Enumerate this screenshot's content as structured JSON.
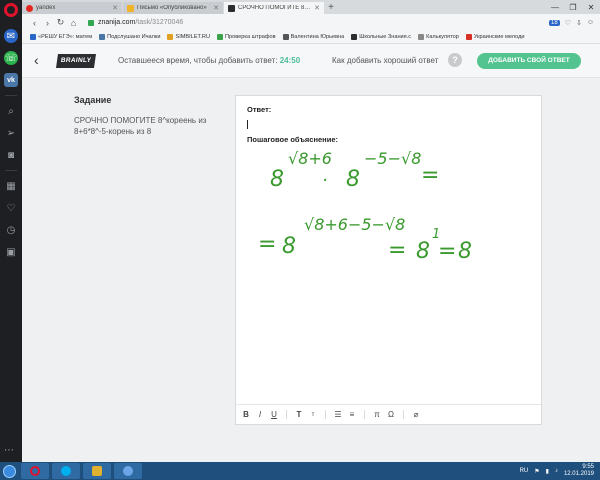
{
  "tabs": [
    {
      "label": "yandex",
      "favicon": "yandex-icon",
      "active": false
    },
    {
      "label": "Письмо «Опубликовано»",
      "favicon": "mail-icon",
      "active": false
    },
    {
      "label": "СРОЧНО ПОМОГИТЕ 8^ко",
      "favicon": "brainly-icon",
      "active": true
    }
  ],
  "address": {
    "domain": "znanija.com",
    "path": "/task/31270046",
    "badge": "18"
  },
  "bookmarks": [
    {
      "label": "«РЕШУ ЕГЭ»: матем",
      "color": "#2a66c7"
    },
    {
      "label": "Подслушано Ичалки",
      "color": "#4a76a8"
    },
    {
      "label": "SIMBILET.RU",
      "color": "#e0a020"
    },
    {
      "label": "Проверка штрафов",
      "color": "#3aa34a"
    },
    {
      "label": "Валентина Юрьевна",
      "color": "#555555"
    },
    {
      "label": "Школьные Знания.с",
      "color": "#2b2d30"
    },
    {
      "label": "Калькулятор",
      "color": "#888888"
    },
    {
      "label": "Украинские мелоди",
      "color": "#d93025"
    }
  ],
  "header": {
    "logo": "BRAINLY",
    "time_label": "Оставшееся время, чтобы добавить ответ:",
    "time_value": "24:50",
    "how_to": "Как добавить хороший ответ",
    "help": "?",
    "add_button": "ДОБАВИТЬ СВОЙ ОТВЕТ"
  },
  "task": {
    "title": "Задание",
    "text": "СРОЧНО ПОМОГИТЕ 8^кореень из 8+6*8^-5-корень из 8"
  },
  "editor": {
    "answer_label": "Ответ:",
    "explanation_label": "Пошаговое объяснение:",
    "handwriting": {
      "base1": "8",
      "exp1": "√8+6",
      "dot": "·",
      "base2": "8",
      "exp2": "−5−√8",
      "eq1": "=",
      "eq2": "=",
      "base3": "8",
      "exp3": "√8+6−5−√8",
      "eq3": "=",
      "base4": "8",
      "exp4": "1",
      "eq4": "=",
      "result": "8"
    },
    "toolbar": {
      "bold": "B",
      "italic": "I",
      "underline": "U",
      "size_big": "T",
      "size_small": "т",
      "list": "☰",
      "list2": "≡",
      "pi": "π",
      "omega": "Ω",
      "attach": "⌀"
    }
  },
  "window_controls": {
    "minimize": "—",
    "maximize": "❐",
    "close": "✕"
  },
  "taskbar": {
    "lang": "RU",
    "time": "9:55",
    "date": "12.01.2019"
  },
  "colors": {
    "accent_green": "#53c38f",
    "timer_green": "#4fbd9a",
    "handwriting_green": "#3a9a2e"
  }
}
